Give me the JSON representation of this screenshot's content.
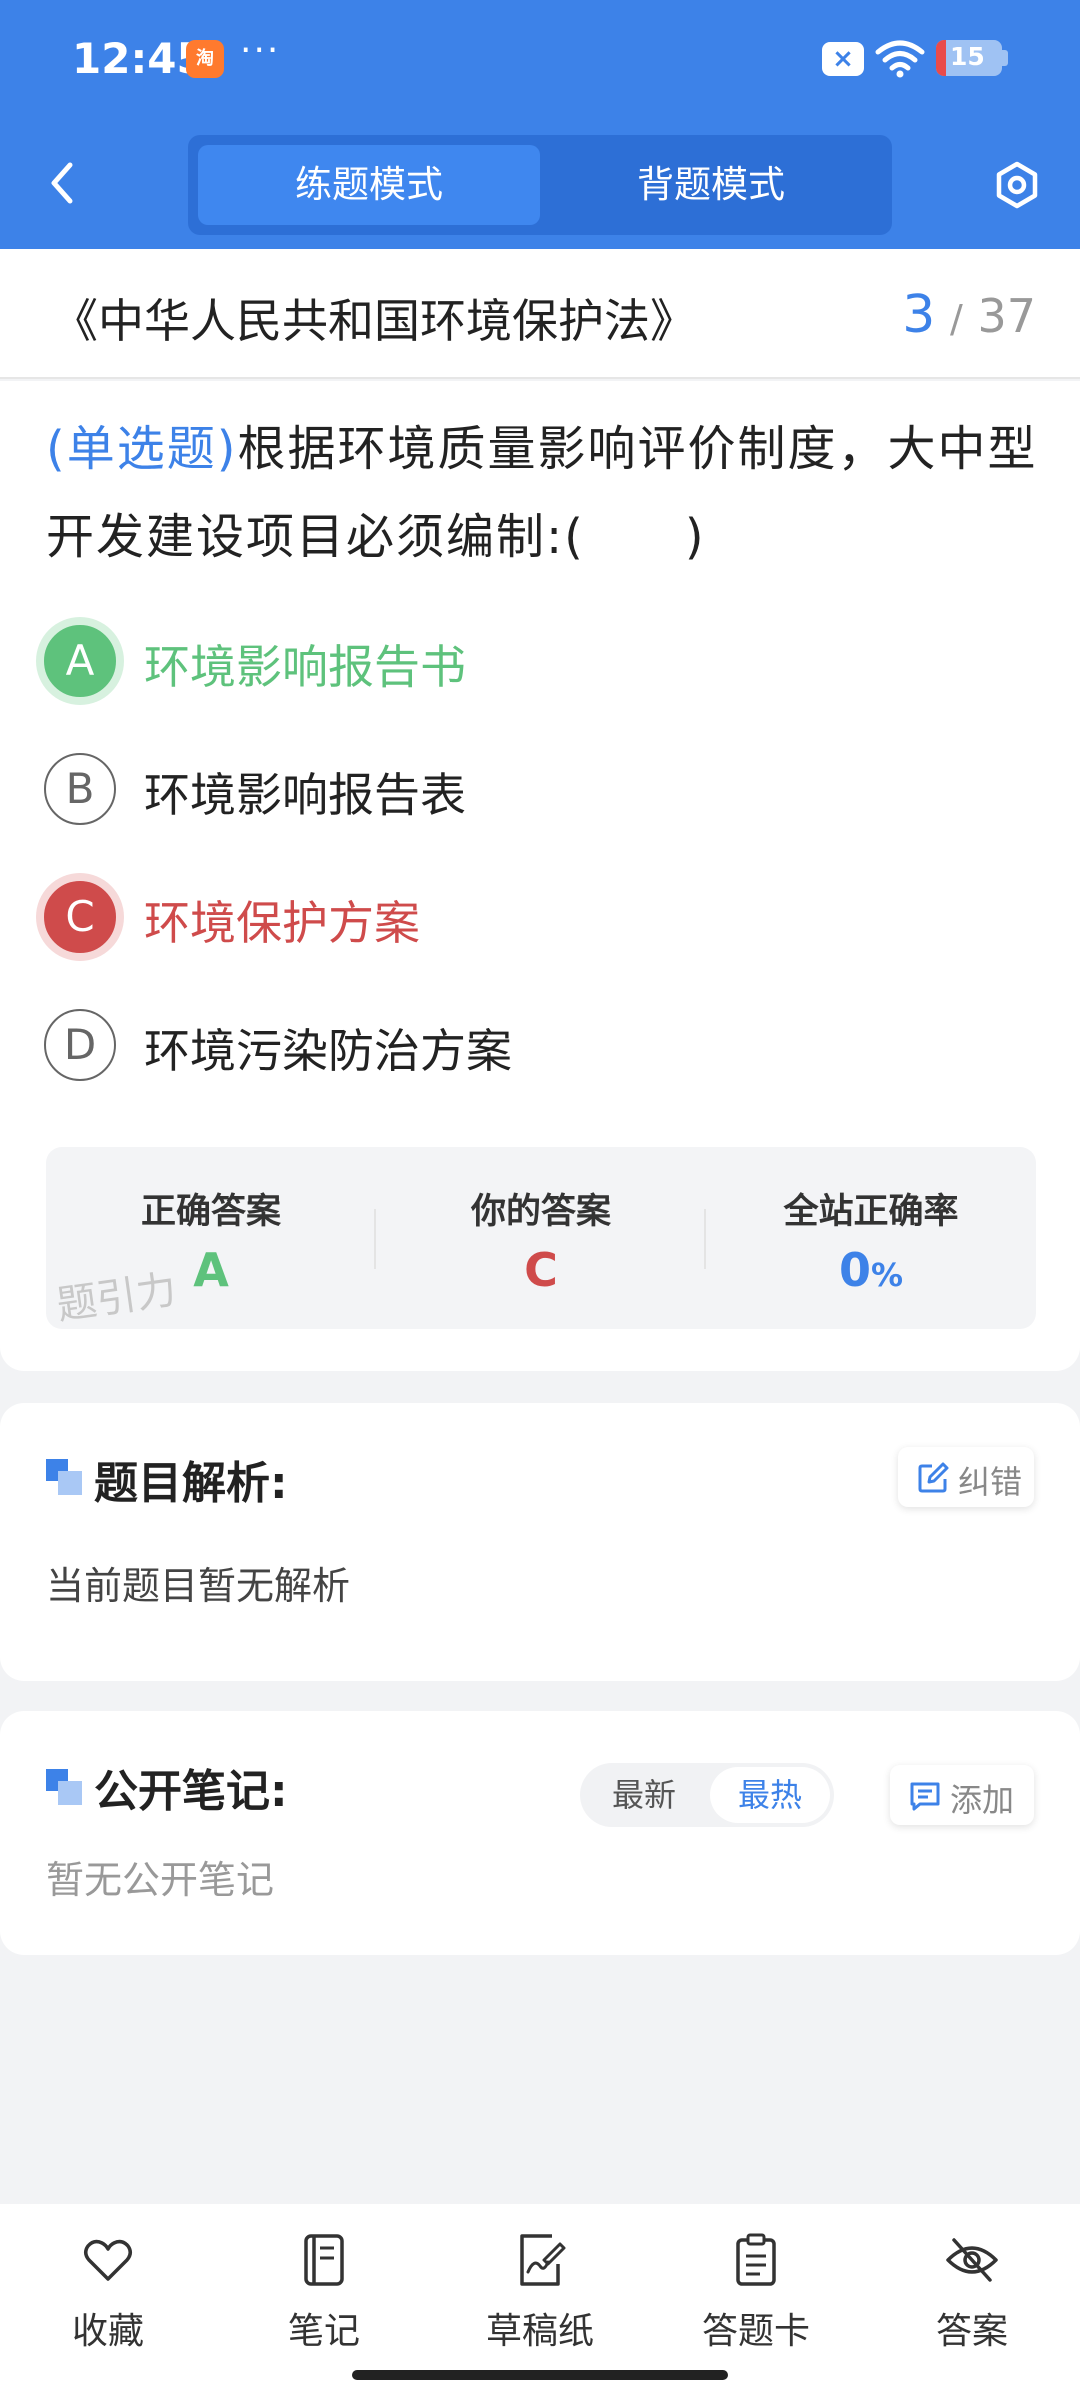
{
  "status_bar": {
    "time": "12:45",
    "more": "···",
    "battery_level": "15",
    "battery_fraction": 0.15,
    "app_notification_icon": "taobao-app-icon"
  },
  "header": {
    "mode_tabs": [
      {
        "label": "练题模式",
        "active": true
      },
      {
        "label": "背题模式",
        "active": false
      }
    ]
  },
  "exam": {
    "title": "《中华人民共和国环境保护法》",
    "current": "3",
    "separator": "/",
    "total": "37"
  },
  "question": {
    "type": "(单选题)",
    "text": "根据环境质量影响评价制度，大中型开发建设项目必须编制:(　　)"
  },
  "options": [
    {
      "letter": "A",
      "text": "环境影响报告书",
      "state": "correct"
    },
    {
      "letter": "B",
      "text": "环境影响报告表",
      "state": "normal"
    },
    {
      "letter": "C",
      "text": "环境保护方案",
      "state": "wrong"
    },
    {
      "letter": "D",
      "text": "环境污染防治方案",
      "state": "normal"
    }
  ],
  "result": {
    "correct_label": "正确答案",
    "correct_value": "A",
    "yours_label": "你的答案",
    "yours_value": "C",
    "rate_label": "全站正确率",
    "rate_value": "0",
    "rate_unit": "%",
    "watermark": "题引力"
  },
  "analysis": {
    "title": "题目解析:",
    "report_label": "纠错",
    "body": "当前题目暂无解析"
  },
  "notes": {
    "title": "公开笔记:",
    "sort_options": [
      "最新",
      "最热"
    ],
    "add_label": "添加",
    "body": "暂无公开笔记"
  },
  "bottom_nav": [
    {
      "label": "收藏",
      "icon": "heart-icon"
    },
    {
      "label": "笔记",
      "icon": "notebook-icon"
    },
    {
      "label": "草稿纸",
      "icon": "draft-paper-icon"
    },
    {
      "label": "答题卡",
      "icon": "answer-sheet-icon"
    },
    {
      "label": "答案",
      "icon": "eye-hidden-icon"
    }
  ],
  "colors": {
    "primary": "#3d82e8",
    "correct": "#5ec27c",
    "wrong": "#cf4b4b"
  }
}
